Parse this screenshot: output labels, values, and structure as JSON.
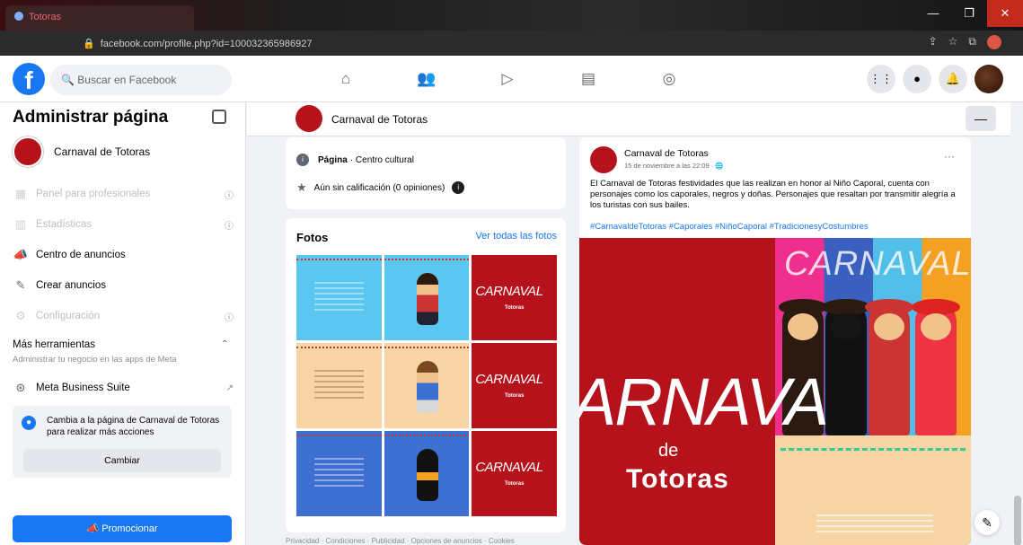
{
  "browser": {
    "tab_title": "Totoras",
    "url": "facebook.com/profile.php?id=100032365986927",
    "win_minimize": "—",
    "win_restore": "❐",
    "win_close": "✕"
  },
  "topnav": {
    "logo": "f",
    "search_placeholder": "Buscar en Facebook",
    "icons": [
      "home-icon",
      "friends-icon",
      "watch-icon",
      "marketplace-icon",
      "gaming-icon"
    ],
    "right_icons": [
      "menu-grid-icon",
      "messenger-icon",
      "notifications-icon",
      "profile-avatar"
    ]
  },
  "sidebar": {
    "title": "Administrar página",
    "page_name": "Carnaval de Totoras",
    "items": [
      {
        "label": "Panel para profesionales",
        "icon": "dashboard-icon",
        "disabled": true
      },
      {
        "label": "Estadísticas",
        "icon": "stats-icon",
        "disabled": true
      },
      {
        "label": "Centro de anuncios",
        "icon": "megaphone-icon",
        "disabled": false
      },
      {
        "label": "Crear anuncios",
        "icon": "edit-icon",
        "disabled": false
      },
      {
        "label": "Configuración",
        "icon": "gear-icon",
        "disabled": true
      }
    ],
    "more_tools_title": "Más herramientas",
    "more_tools_sub": "Administrar tu negocio en las apps de Meta",
    "meta_suite": "Meta Business Suite",
    "switch_message": "Cambia a la página de Carnaval de Totoras para realizar más acciones",
    "switch_button": "Cambiar",
    "promote_button": "Promocionar"
  },
  "page_header": {
    "name": "Carnaval de Totoras",
    "more": "—"
  },
  "info": {
    "type_label": "Página",
    "type_value": "· Centro cultural",
    "rating": "Aún sin calificación (0 opiniones)"
  },
  "photos": {
    "title": "Fotos",
    "see_all": "Ver todas las fotos",
    "tile_text_1": "CARNAVAL",
    "tile_text_2": "Totoras"
  },
  "post": {
    "author": "Carnaval de Totoras",
    "date": "15 de noviembre a las 22:09 · ",
    "text": "El Carnaval de Totoras festividades que las realizan en honor al Niño Caporal, cuenta con personajes como los caporales, negros y doñas. Personajes que resaltan por transmitir alegría a los turistas con sus bailes.",
    "tags": "#CarnavaldeTotoras #Caporales #NiñoCaporal #TradicionesyCostumbres",
    "image_big": "ARNAVA",
    "image_de": "de",
    "image_totoras": "Totoras",
    "image_carnaval": "CARNAVAL"
  },
  "footer": "Privacidad · Condiciones · Publicidad · Opciones de anuncios · Cookies"
}
